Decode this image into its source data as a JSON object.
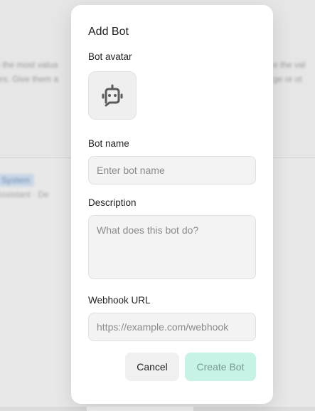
{
  "background": {
    "line1": "s the most valua",
    "line2": "ers. Give them a",
    "line3": "e the val",
    "line4": "ge or ot",
    "tag": "System",
    "sub": "Assistant · De"
  },
  "modal": {
    "title": "Add Bot",
    "avatar_label": "Bot avatar",
    "avatar_icon": "bot-icon",
    "name_label": "Bot name",
    "name_placeholder": "Enter bot name",
    "name_value": "",
    "description_label": "Description",
    "description_placeholder": "What does this bot do?",
    "description_value": "",
    "webhook_label": "Webhook URL",
    "webhook_placeholder": "https://example.com/webhook",
    "webhook_value": "",
    "cancel_label": "Cancel",
    "create_label": "Create Bot"
  },
  "colors": {
    "primary_disabled": "#c7f2e6",
    "primary_text_disabled": "#7a9a92"
  }
}
